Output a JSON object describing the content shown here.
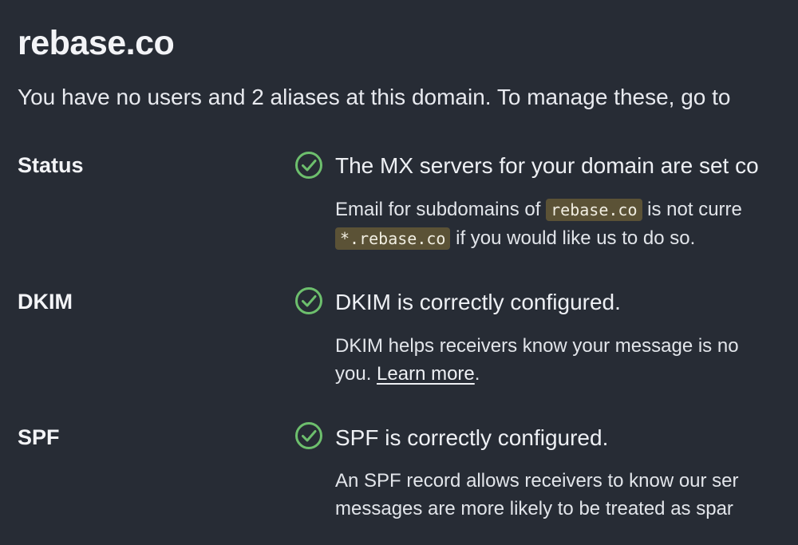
{
  "page": {
    "title": "rebase.co",
    "intro": "You have no users and 2 aliases at this domain. To manage these, go to"
  },
  "colors": {
    "background": "#272c35",
    "check_green": "#6dbf6d",
    "code_bg": "#5b5236"
  },
  "rows": [
    {
      "label": "Status",
      "icon": "check-circle-icon",
      "heading": "The MX servers for your domain are set co",
      "desc_line1_prefix": "Email for subdomains of ",
      "desc_line1_code": "rebase.co",
      "desc_line1_suffix": " is not curre",
      "desc_line2_code": "*.rebase.co",
      "desc_line2_suffix": " if you would like us to do so."
    },
    {
      "label": "DKIM",
      "icon": "check-circle-icon",
      "heading": "DKIM is correctly configured.",
      "desc_line1": "DKIM helps receivers know your message is no",
      "desc_line2_prefix": "you. ",
      "desc_line2_link": "Learn more",
      "desc_line2_suffix": "."
    },
    {
      "label": "SPF",
      "icon": "check-circle-icon",
      "heading": "SPF is correctly configured.",
      "desc_line1": "An SPF record allows receivers to know our ser",
      "desc_line2": "messages are more likely to be treated as spar"
    }
  ]
}
